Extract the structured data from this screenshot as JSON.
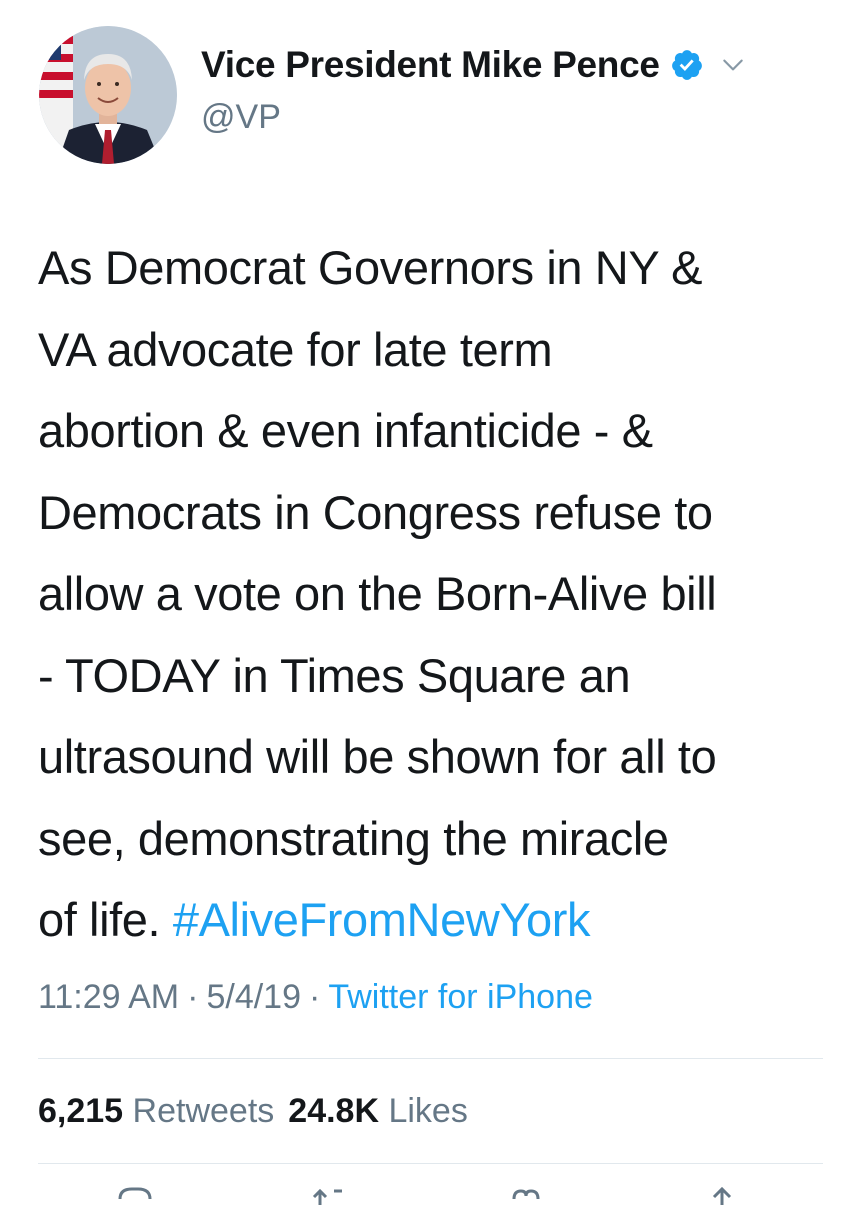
{
  "author": {
    "display_name": "Vice President Mike Pence",
    "handle": "@VP",
    "verified": true
  },
  "tweet": {
    "lines": [
      "As Democrat Governors in NY &",
      "VA advocate for late term",
      "abortion & even infanticide - &",
      "Democrats in Congress refuse to",
      "allow a vote on the Born-Alive bill",
      "- TODAY in Times Square an",
      "ultrasound will be shown for all to",
      "see, demonstrating the miracle"
    ],
    "last_line_prefix": "of life. ",
    "hashtag": "#AliveFromNewYork"
  },
  "meta": {
    "time": "11:29 AM",
    "separator": "·",
    "date": "5/4/19",
    "source": "Twitter for iPhone"
  },
  "stats": {
    "retweets_count": "6,215",
    "retweets_label": "Retweets",
    "likes_count": "24.8K",
    "likes_label": "Likes"
  },
  "icons": {
    "verified": "verified-badge-icon",
    "more": "chevron-down-icon",
    "reply": "reply-icon",
    "retweet": "retweet-icon",
    "like": "heart-icon",
    "share": "share-icon"
  },
  "colors": {
    "text": "#14171a",
    "secondary": "#657786",
    "link": "#1da1f2",
    "divider": "#e1e8ed"
  }
}
